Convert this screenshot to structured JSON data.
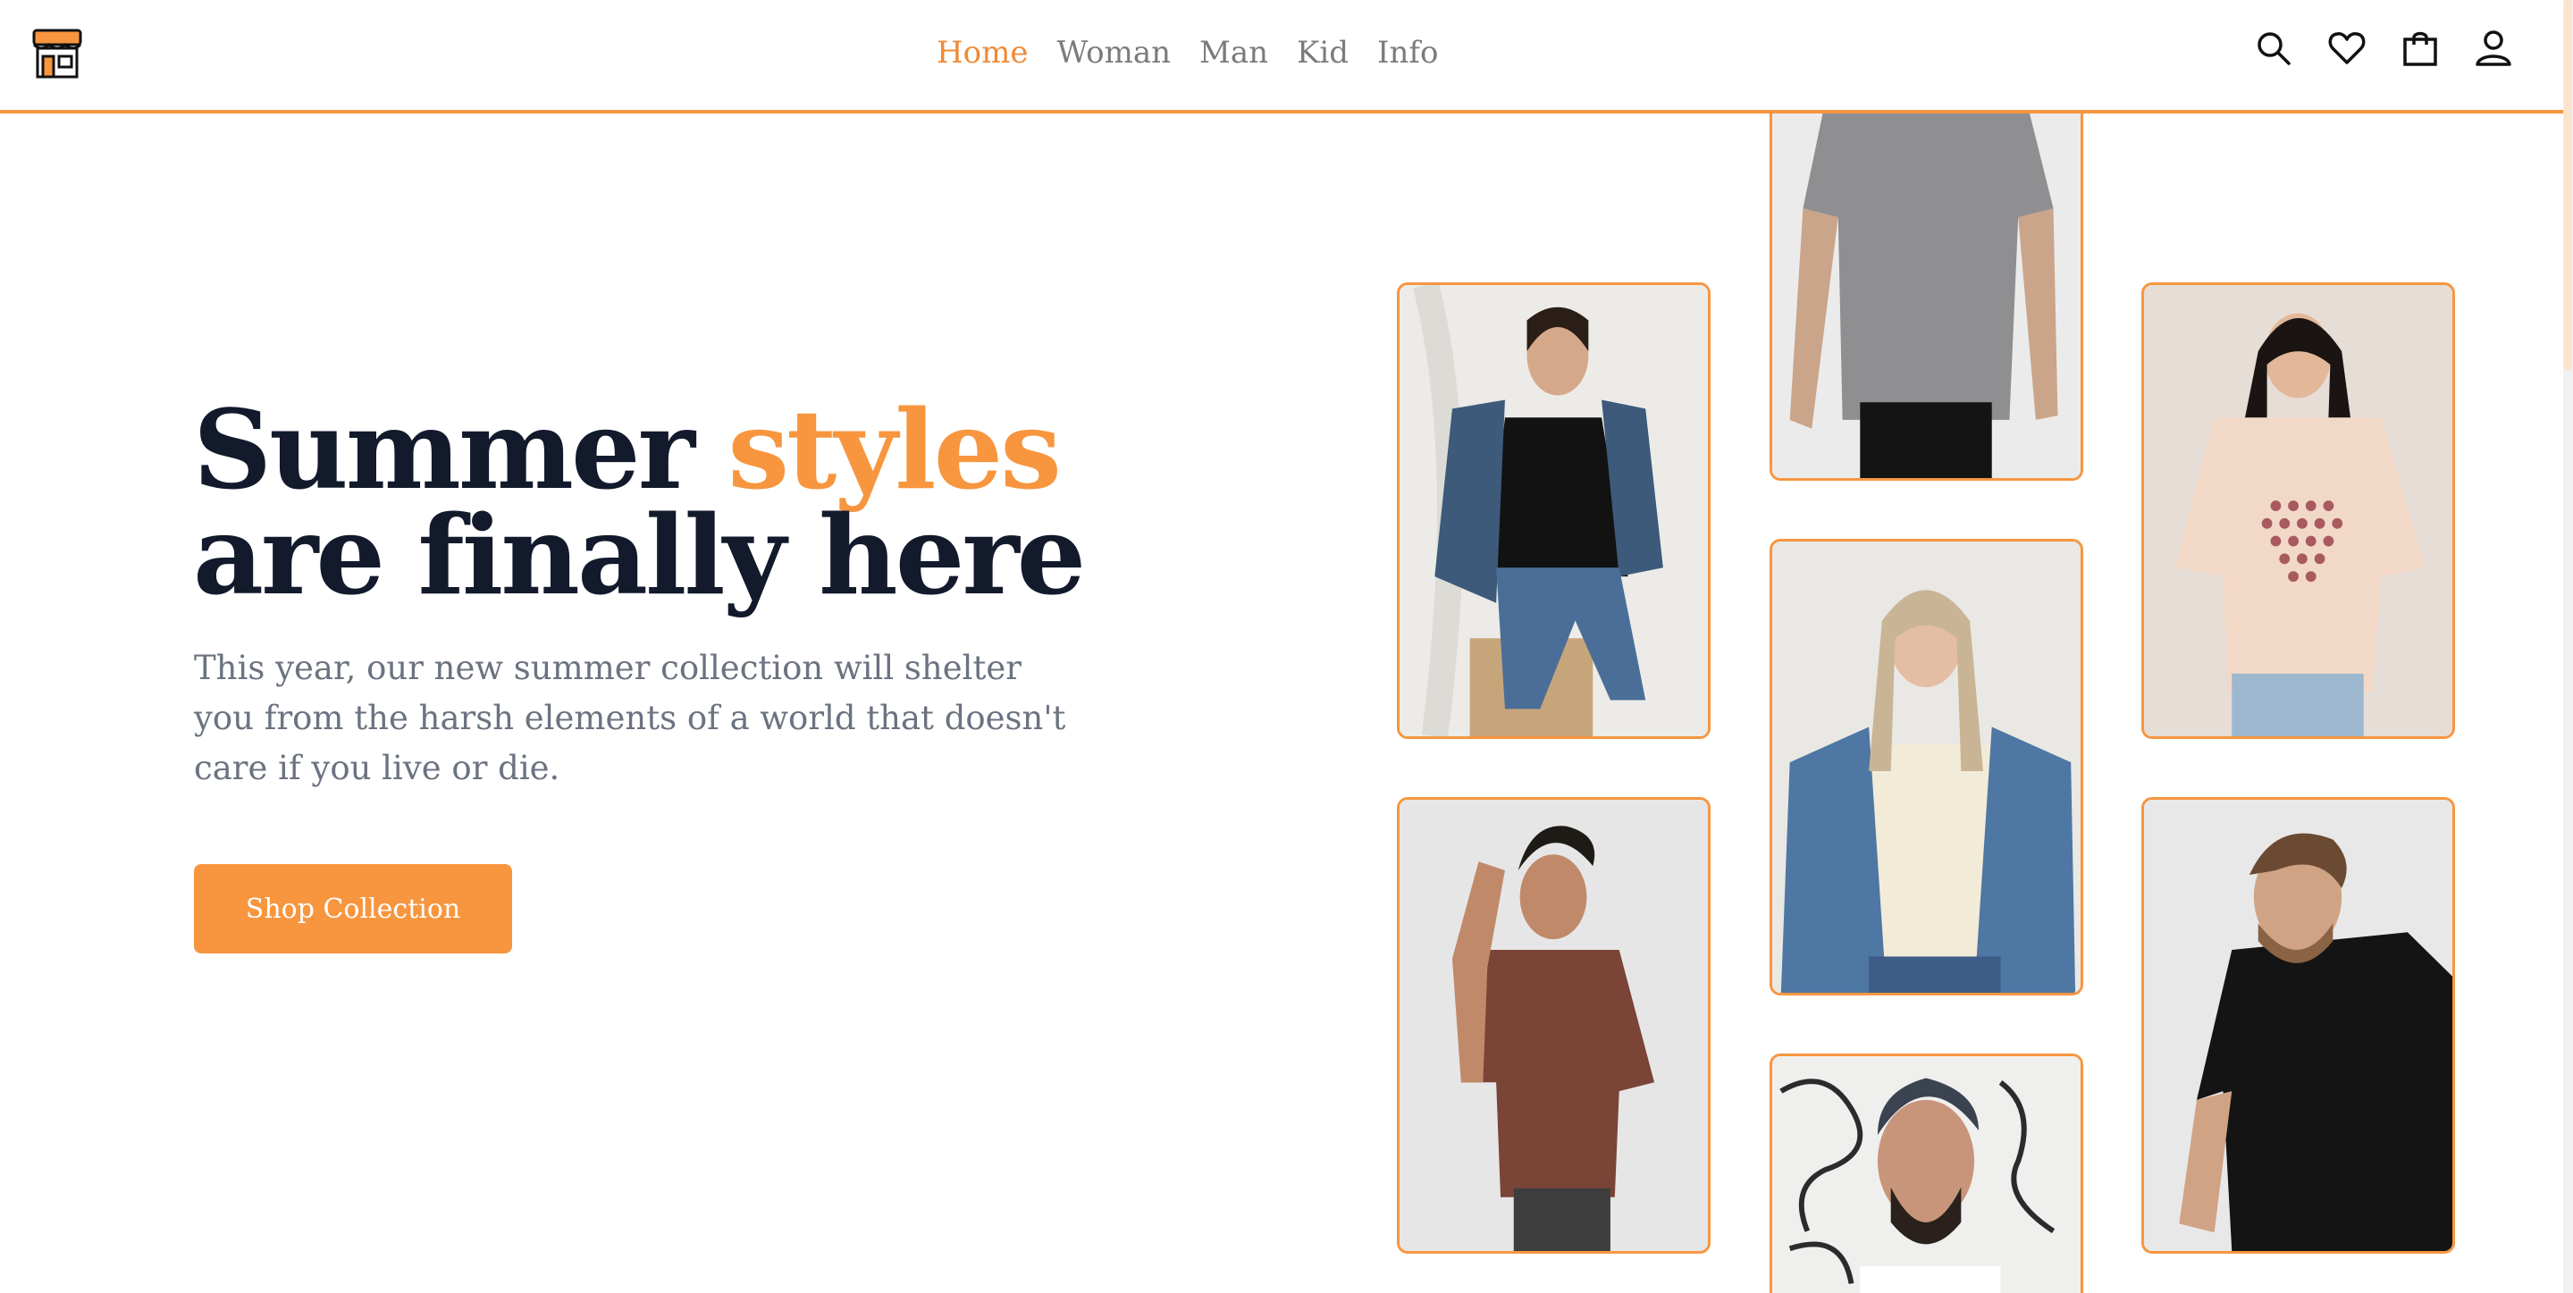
{
  "header": {
    "logo": "storefront-icon",
    "nav": [
      {
        "label": "Home",
        "active": true
      },
      {
        "label": "Woman",
        "active": false
      },
      {
        "label": "Man",
        "active": false
      },
      {
        "label": "Kid",
        "active": false
      },
      {
        "label": "Info",
        "active": false
      }
    ],
    "icons": [
      "search-icon",
      "heart-icon",
      "shopping-bag-icon",
      "user-icon"
    ]
  },
  "hero": {
    "title_part1": "Summer ",
    "title_accent": "styles",
    "title_part2": "are finally here",
    "description": "This year, our new summer collection will shelter you from the harsh elements of a world that doesn't care if you live or die.",
    "cta_label": "Shop Collection"
  },
  "gallery": [
    "woman-denim-jacket-black-tee-photo",
    "man-grey-tee-photo",
    "woman-pink-printed-tee-photo",
    "woman-cream-tee-denim-jacket-photo",
    "man-brown-tee-photo",
    "man-black-tee-photo",
    "man-beanie-glasses-photo"
  ],
  "colors": {
    "accent": "#f7963f",
    "nav_active": "#f08a34",
    "heading": "#121a2c",
    "body_text": "#6b7280"
  }
}
